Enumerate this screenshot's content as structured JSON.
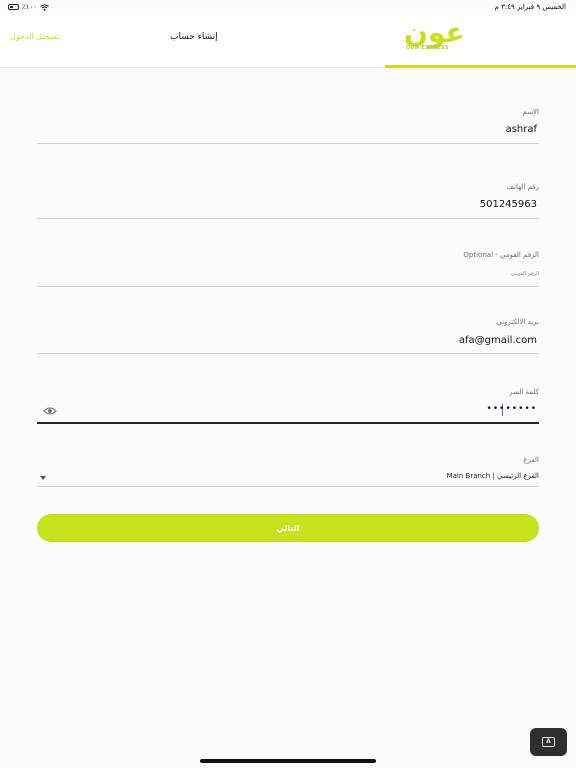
{
  "status_bar": {
    "battery": "٪١٠٠",
    "datetime": "الخميس ٩ فبراير ٣:٤٩ م"
  },
  "header": {
    "login_link": "تسجيل الدخول",
    "register_tab": "إنشاء حساب",
    "logo": {
      "brand": "عون",
      "sub": "OUN EXPRESS"
    }
  },
  "form": {
    "name": {
      "label": "الاسم",
      "value": "ashraf"
    },
    "phone": {
      "label": "رقم الهاتف",
      "value": "501245963"
    },
    "national_id": {
      "label": "الرقم القومي - Optional",
      "placeholder": "الرقم القومي"
    },
    "email": {
      "label": "بريد الالكتروني",
      "value": "afa@gmail.com"
    },
    "password": {
      "label": "كلمة السر",
      "value": "••••••••"
    },
    "branch": {
      "label": "الفرع",
      "value": "الفرع الرئيسي | Main Branch"
    }
  },
  "actions": {
    "next_label": "التالي"
  },
  "colors": {
    "accent": "#c5e31c",
    "background": "#fbfafc"
  }
}
